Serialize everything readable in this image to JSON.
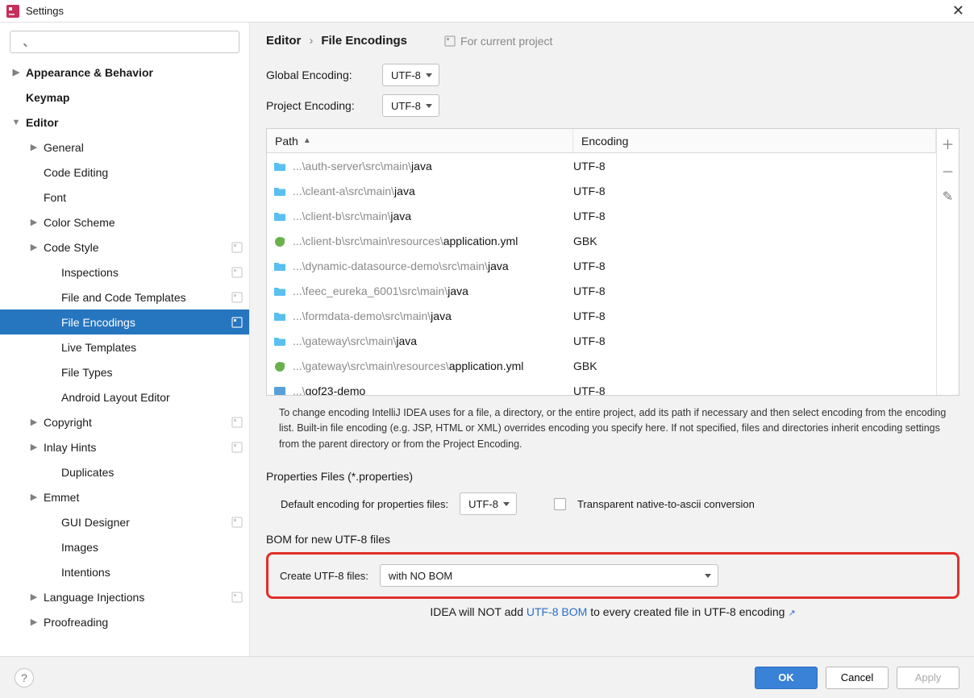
{
  "window": {
    "title": "Settings"
  },
  "search": {
    "placeholder": ""
  },
  "sidebar": {
    "items": [
      {
        "label": "Appearance & Behavior",
        "level": 0,
        "arrow": "▶",
        "bold": true
      },
      {
        "label": "Keymap",
        "level": 0,
        "arrow": "",
        "bold": true
      },
      {
        "label": "Editor",
        "level": 0,
        "arrow": "▼",
        "bold": true
      },
      {
        "label": "General",
        "level": 1,
        "arrow": "▶"
      },
      {
        "label": "Code Editing",
        "level": 1,
        "arrow": ""
      },
      {
        "label": "Font",
        "level": 1,
        "arrow": ""
      },
      {
        "label": "Color Scheme",
        "level": 1,
        "arrow": "▶"
      },
      {
        "label": "Code Style",
        "level": 1,
        "arrow": "▶",
        "badge": true
      },
      {
        "label": "Inspections",
        "level": 2,
        "arrow": "",
        "badge": true
      },
      {
        "label": "File and Code Templates",
        "level": 2,
        "arrow": "",
        "badge": true
      },
      {
        "label": "File Encodings",
        "level": 2,
        "arrow": "",
        "badge": true,
        "selected": true
      },
      {
        "label": "Live Templates",
        "level": 2,
        "arrow": ""
      },
      {
        "label": "File Types",
        "level": 2,
        "arrow": ""
      },
      {
        "label": "Android Layout Editor",
        "level": 2,
        "arrow": ""
      },
      {
        "label": "Copyright",
        "level": 1,
        "arrow": "▶",
        "badge": true
      },
      {
        "label": "Inlay Hints",
        "level": 1,
        "arrow": "▶",
        "badge": true
      },
      {
        "label": "Duplicates",
        "level": 2,
        "arrow": ""
      },
      {
        "label": "Emmet",
        "level": 1,
        "arrow": "▶"
      },
      {
        "label": "GUI Designer",
        "level": 2,
        "arrow": "",
        "badge": true
      },
      {
        "label": "Images",
        "level": 2,
        "arrow": ""
      },
      {
        "label": "Intentions",
        "level": 2,
        "arrow": ""
      },
      {
        "label": "Language Injections",
        "level": 1,
        "arrow": "▶",
        "badge": true
      },
      {
        "label": "Proofreading",
        "level": 1,
        "arrow": "▶"
      }
    ]
  },
  "breadcrumb": {
    "a": "Editor",
    "b": "File Encodings",
    "proj": "For current project"
  },
  "global": {
    "label": "Global Encoding:",
    "value": "UTF-8"
  },
  "project": {
    "label": "Project Encoding:",
    "value": "UTF-8"
  },
  "table": {
    "col_path": "Path",
    "col_enc": "Encoding",
    "rows": [
      {
        "icon": "folder",
        "gray": "...\\auth-server\\src\\main\\",
        "blk": "java",
        "enc": "UTF-8"
      },
      {
        "icon": "folder",
        "gray": "...\\cleant-a\\src\\main\\",
        "blk": "java",
        "enc": "UTF-8"
      },
      {
        "icon": "folder",
        "gray": "...\\client-b\\src\\main\\",
        "blk": "java",
        "enc": "UTF-8"
      },
      {
        "icon": "yml",
        "gray": "...\\client-b\\src\\main\\resources\\",
        "blk": "application.yml",
        "enc": "GBK"
      },
      {
        "icon": "folder",
        "gray": "...\\dynamic-datasource-demo\\src\\main\\",
        "blk": "java",
        "enc": "UTF-8"
      },
      {
        "icon": "folder",
        "gray": "...\\feec_eureka_6001\\src\\main\\",
        "blk": "java",
        "enc": "UTF-8"
      },
      {
        "icon": "folder",
        "gray": "...\\formdata-demo\\src\\main\\",
        "blk": "java",
        "enc": "UTF-8"
      },
      {
        "icon": "folder",
        "gray": "...\\gateway\\src\\main\\",
        "blk": "java",
        "enc": "UTF-8"
      },
      {
        "icon": "yml",
        "gray": "...\\gateway\\src\\main\\resources\\",
        "blk": "application.yml",
        "enc": "GBK"
      },
      {
        "icon": "mod",
        "gray": "...\\",
        "blk": "gof23-demo",
        "enc": "UTF-8"
      }
    ]
  },
  "desc": "To change encoding IntelliJ IDEA uses for a file, a directory, or the entire project, add its path if necessary and then select encoding from the encoding list. Built-in file encoding (e.g. JSP, HTML or XML) overrides encoding you specify here. If not specified, files and directories inherit encoding settings from the parent directory or from the Project Encoding.",
  "props": {
    "section": "Properties Files (*.properties)",
    "label": "Default encoding for properties files:",
    "value": "UTF-8",
    "chk_label": "Transparent native-to-ascii conversion"
  },
  "bom": {
    "section": "BOM for new UTF-8 files",
    "label": "Create UTF-8 files:",
    "value": "with NO BOM",
    "hint_pre": "IDEA will NOT add ",
    "hint_link": "UTF-8 BOM",
    "hint_post": " to every created file in UTF-8 encoding"
  },
  "footer": {
    "ok": "OK",
    "cancel": "Cancel",
    "apply": "Apply"
  }
}
